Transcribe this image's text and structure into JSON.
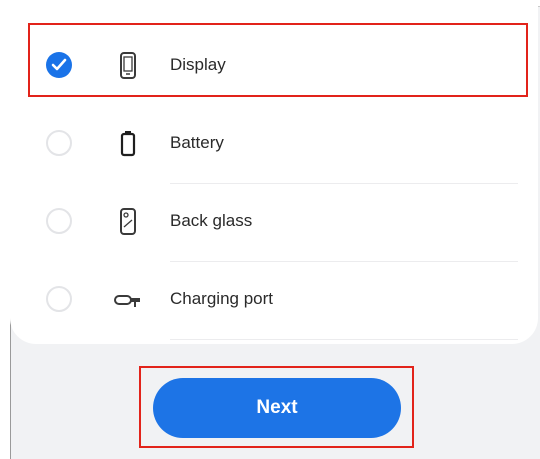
{
  "options": [
    {
      "label": "Display",
      "icon": "phone-display-icon",
      "selected": true
    },
    {
      "label": "Battery",
      "icon": "battery-icon",
      "selected": false
    },
    {
      "label": "Back glass",
      "icon": "phone-back-glass-icon",
      "selected": false
    },
    {
      "label": "Charging port",
      "icon": "charging-port-icon",
      "selected": false
    }
  ],
  "next_button": {
    "label": "Next"
  },
  "colors": {
    "accent": "#1d74e6",
    "highlight": "#e2231a",
    "background": "#f1f2f4"
  }
}
